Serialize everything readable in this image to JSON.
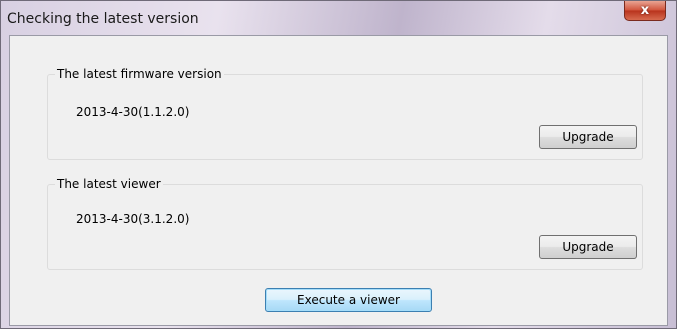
{
  "window": {
    "title": "Checking the latest version",
    "close_label": "x"
  },
  "firmware": {
    "legend": "The latest firmware version",
    "version": "2013-4-30(1.1.2.0)",
    "upgrade_label": "Upgrade"
  },
  "viewer": {
    "legend": "The latest viewer",
    "version": "2013-4-30(3.1.2.0)",
    "upgrade_label": "Upgrade"
  },
  "execute_label": "Execute a viewer",
  "icons": {
    "close": "close-icon"
  }
}
